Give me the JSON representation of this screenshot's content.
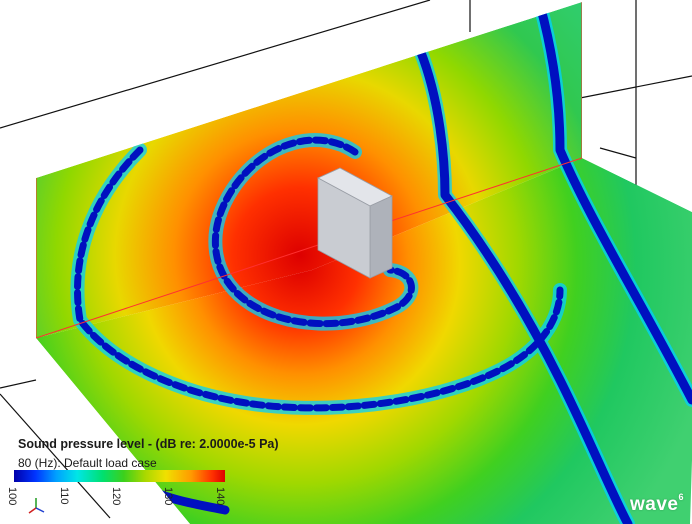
{
  "legend": {
    "title": "Sound pressure level - (dB re: 2.0000e-5 Pa)",
    "subtitle": "80 (Hz): Default load case",
    "ticks": [
      "100",
      "110",
      "120",
      "130",
      "140"
    ],
    "scale_min": 100,
    "scale_max": 140
  },
  "brand": {
    "name": "wave",
    "superscript": "6"
  },
  "colors": {
    "background": "#ffffff",
    "max_red": "#dd0000",
    "min_blue": "#0000aa",
    "speaker_box": "#c9ccd2"
  }
}
